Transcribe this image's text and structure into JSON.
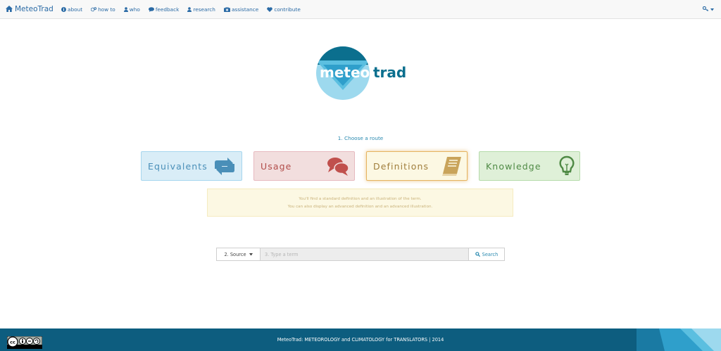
{
  "navbar": {
    "brand": "MeteoTrad",
    "links": [
      {
        "label": "about",
        "icon": "info-circle-icon"
      },
      {
        "label": "how to",
        "icon": "gears-icon"
      },
      {
        "label": "who",
        "icon": "user-icon"
      },
      {
        "label": "feedback",
        "icon": "comment-icon"
      },
      {
        "label": "research",
        "icon": "users-icon"
      },
      {
        "label": "assistance",
        "icon": "medkit-icon"
      },
      {
        "label": "contribute",
        "icon": "heart-icon"
      }
    ],
    "right_icon": "key-icon"
  },
  "logo": {
    "part1": "meteo",
    "part2": "trad"
  },
  "route": {
    "label": "1. Choose a route",
    "cards": [
      {
        "label": "Equivalents",
        "icon": "retweet-icon",
        "color": "#4a8fb8"
      },
      {
        "label": "Usage",
        "icon": "comments-icon",
        "color": "#b24d4a"
      },
      {
        "label": "Definitions",
        "icon": "book-icon",
        "color": "#c9a45b",
        "selected": true
      },
      {
        "label": "Knowledge",
        "icon": "lightbulb-icon",
        "color": "#4f8a45"
      }
    ]
  },
  "info": {
    "line1": "You'll find a standard definition and an illustration of the term.",
    "line2": "You can also display an advanced definition and an advanced illustration."
  },
  "search": {
    "source_label": "2. Source",
    "placeholder": "3. Type a term",
    "value": "",
    "button_label": "Search"
  },
  "footer": {
    "text": "MeteoTrad: METEOROLOGY and CLIMATOLOGY for TRANSLATORS | 2014",
    "badge": "cc-by-nc-sa-badge"
  },
  "colors": {
    "link": "#2a6aa5",
    "footer_bg": "#0d5d7f",
    "logo_dark": "#0b6f8e",
    "logo_light": "#5bbfe0"
  }
}
